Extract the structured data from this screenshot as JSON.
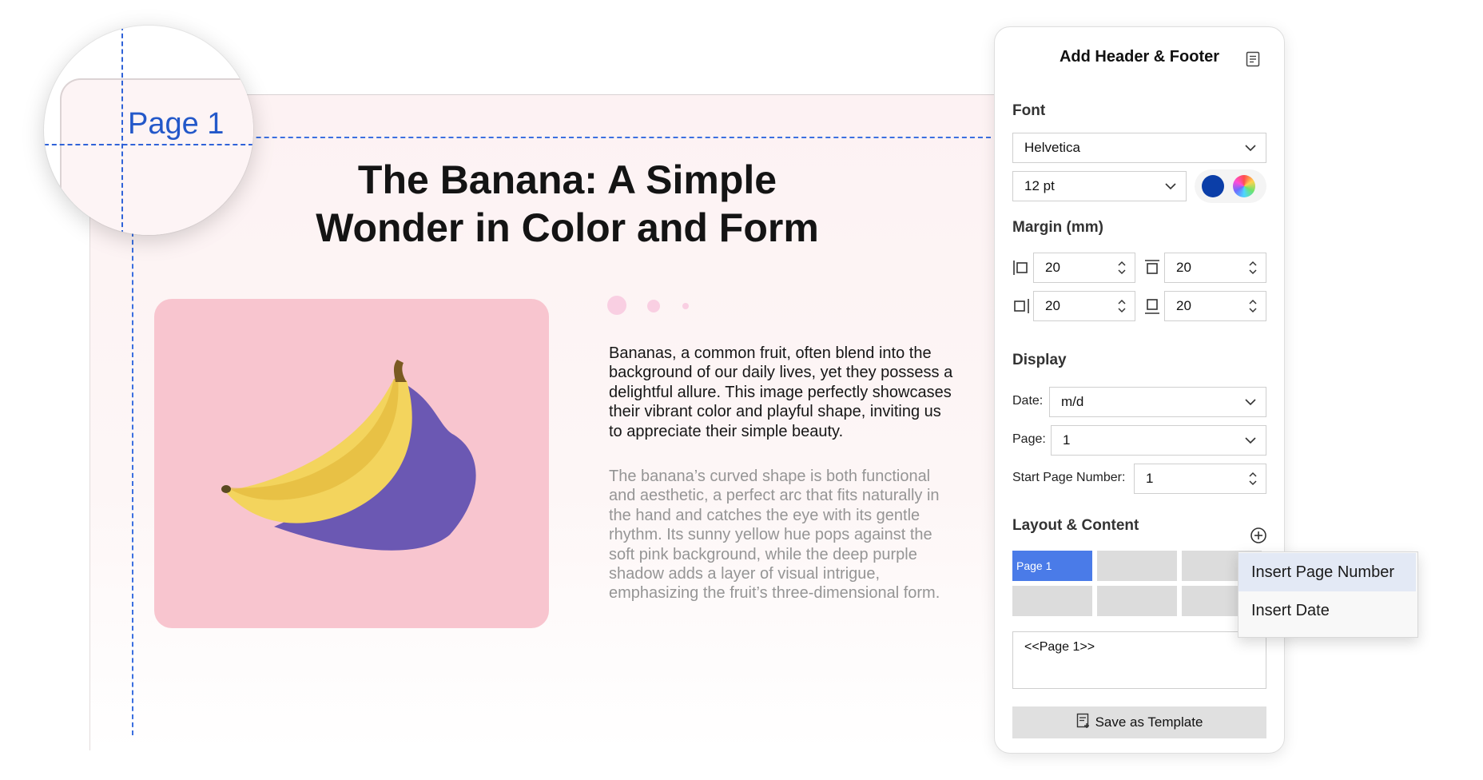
{
  "document": {
    "title_lines": [
      "The Banana: A Simple",
      "Wonder in Color and Form"
    ],
    "paragraph1": [
      "Bananas, a common fruit, often blend into the",
      "background of our daily lives, yet they possess a",
      "delightful allure. This image perfectly showcases",
      "their vibrant color and playful shape, inviting us",
      "to appreciate their simple beauty."
    ],
    "paragraph2": [
      "The banana’s curved shape is both functional",
      "and aesthetic, a perfect arc that fits naturally in",
      "the hand and catches the eye with its gentle",
      "rhythm. Its sunny yellow hue pops against the",
      "soft pink background, while the deep purple",
      "shadow adds a layer of visual intrigue,",
      "emphasizing the fruit’s three-dimensional form."
    ]
  },
  "magnifier": {
    "label": "Page 1"
  },
  "panel": {
    "title": "Add Header & Footer",
    "font": {
      "label": "Font",
      "family": "Helvetica",
      "size": "12 pt",
      "color": "#0b3ea8"
    },
    "margin": {
      "label": "Margin (mm)",
      "left": "20",
      "top": "20",
      "right": "20",
      "bottom": "20"
    },
    "display": {
      "label": "Display",
      "date_label": "Date:",
      "date_value": "m/d",
      "page_label": "Page:",
      "page_value": "1",
      "start_label": "Start Page Number:",
      "start_value": "1"
    },
    "layout": {
      "label": "Layout & Content",
      "selected_tile": "Page 1",
      "content_text": "<<Page 1>>"
    },
    "save_label": "Save as Template"
  },
  "context_menu": {
    "items": [
      "Insert Page Number",
      "Insert Date"
    ]
  },
  "colors": {
    "accent": "#4a7be8",
    "guide": "#3b6fe0",
    "card_bg": "#f8c5cf"
  }
}
